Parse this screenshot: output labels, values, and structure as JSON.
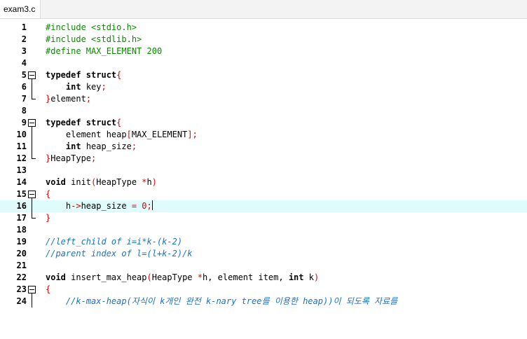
{
  "tab": {
    "label": "exam3.c"
  },
  "editor": {
    "current_line": 16,
    "lines": [
      {
        "n": "1",
        "fold": "",
        "tokens": [
          {
            "t": "#include <stdio.h>",
            "c": "pre"
          }
        ]
      },
      {
        "n": "2",
        "fold": "",
        "tokens": [
          {
            "t": "#include <stdlib.h>",
            "c": "pre"
          }
        ]
      },
      {
        "n": "3",
        "fold": "",
        "tokens": [
          {
            "t": "#define MAX_ELEMENT 200",
            "c": "pre"
          }
        ]
      },
      {
        "n": "4",
        "fold": "",
        "tokens": []
      },
      {
        "n": "5",
        "fold": "start",
        "tokens": [
          {
            "t": "typedef struct",
            "c": "kw"
          },
          {
            "t": "{",
            "c": "br"
          }
        ]
      },
      {
        "n": "6",
        "fold": "mid",
        "tokens": [
          {
            "t": "    "
          },
          {
            "t": "int",
            "c": "kw"
          },
          {
            "t": " key"
          },
          {
            "t": ";",
            "c": "op"
          }
        ]
      },
      {
        "n": "7",
        "fold": "end",
        "tokens": [
          {
            "t": "}",
            "c": "br"
          },
          {
            "t": "element"
          },
          {
            "t": ";",
            "c": "op"
          }
        ]
      },
      {
        "n": "8",
        "fold": "",
        "tokens": []
      },
      {
        "n": "9",
        "fold": "start",
        "tokens": [
          {
            "t": "typedef struct",
            "c": "kw"
          },
          {
            "t": "{",
            "c": "br"
          }
        ]
      },
      {
        "n": "10",
        "fold": "mid",
        "tokens": [
          {
            "t": "    element heap"
          },
          {
            "t": "[",
            "c": "br"
          },
          {
            "t": "MAX_ELEMENT"
          },
          {
            "t": "]",
            "c": "br"
          },
          {
            "t": ";",
            "c": "op"
          }
        ]
      },
      {
        "n": "11",
        "fold": "mid",
        "tokens": [
          {
            "t": "    "
          },
          {
            "t": "int",
            "c": "kw"
          },
          {
            "t": " heap_size"
          },
          {
            "t": ";",
            "c": "op"
          }
        ]
      },
      {
        "n": "12",
        "fold": "end",
        "tokens": [
          {
            "t": "}",
            "c": "br"
          },
          {
            "t": "HeapType"
          },
          {
            "t": ";",
            "c": "op"
          }
        ]
      },
      {
        "n": "13",
        "fold": "",
        "tokens": []
      },
      {
        "n": "14",
        "fold": "",
        "tokens": [
          {
            "t": "void",
            "c": "kw"
          },
          {
            "t": " init"
          },
          {
            "t": "(",
            "c": "br"
          },
          {
            "t": "HeapType "
          },
          {
            "t": "*",
            "c": "op"
          },
          {
            "t": "h"
          },
          {
            "t": ")",
            "c": "br"
          }
        ]
      },
      {
        "n": "15",
        "fold": "start",
        "tokens": [
          {
            "t": "{",
            "c": "br"
          }
        ]
      },
      {
        "n": "16",
        "fold": "mid",
        "tokens": [
          {
            "t": "    h"
          },
          {
            "t": "->",
            "c": "op"
          },
          {
            "t": "heap_size "
          },
          {
            "t": "=",
            "c": "op"
          },
          {
            "t": " "
          },
          {
            "t": "0",
            "c": "op"
          },
          {
            "t": ";",
            "c": "op"
          }
        ]
      },
      {
        "n": "17",
        "fold": "end",
        "tokens": [
          {
            "t": "}",
            "c": "br"
          }
        ]
      },
      {
        "n": "18",
        "fold": "",
        "tokens": []
      },
      {
        "n": "19",
        "fold": "",
        "tokens": [
          {
            "t": "//left_child of i=i*k-(k-2)",
            "c": "cm"
          }
        ]
      },
      {
        "n": "20",
        "fold": "",
        "tokens": [
          {
            "t": "//parent index of l=(l+k-2)/k",
            "c": "cm"
          }
        ]
      },
      {
        "n": "21",
        "fold": "",
        "tokens": []
      },
      {
        "n": "22",
        "fold": "",
        "tokens": [
          {
            "t": "void",
            "c": "kw"
          },
          {
            "t": " insert_max_heap"
          },
          {
            "t": "(",
            "c": "br"
          },
          {
            "t": "HeapType "
          },
          {
            "t": "*",
            "c": "op"
          },
          {
            "t": "h, element item, "
          },
          {
            "t": "int",
            "c": "kw"
          },
          {
            "t": " k"
          },
          {
            "t": ")",
            "c": "br"
          }
        ]
      },
      {
        "n": "23",
        "fold": "start",
        "tokens": [
          {
            "t": "{",
            "c": "br"
          }
        ]
      },
      {
        "n": "24",
        "fold": "mid",
        "tokens": [
          {
            "t": "    //k-max-heap(자식이 k개인 완전 k-nary tree를 이용한 heap))이 되도록 자료를",
            "c": "cm"
          }
        ]
      }
    ]
  }
}
